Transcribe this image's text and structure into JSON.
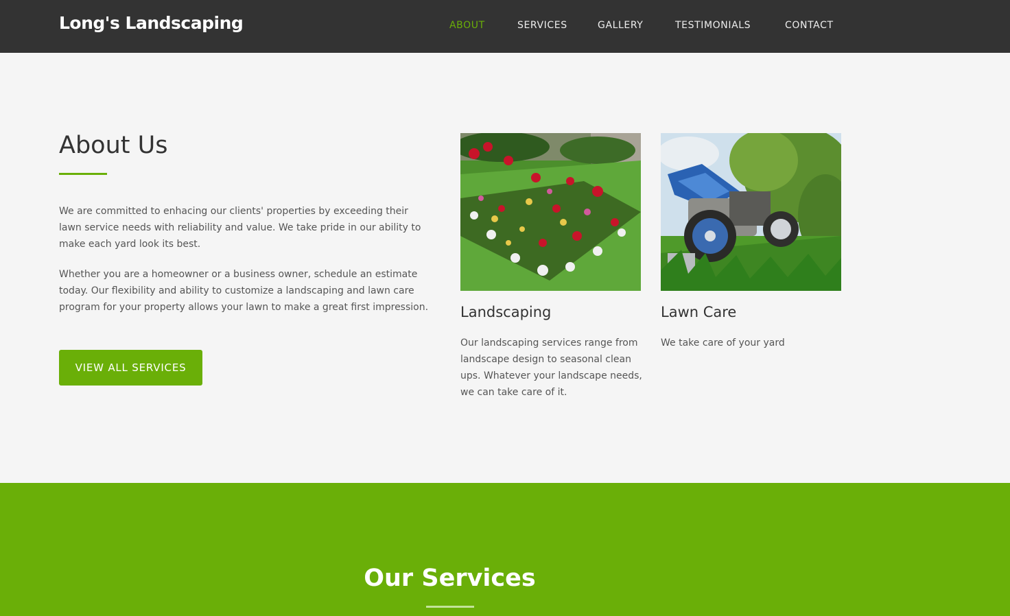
{
  "header": {
    "brand": "Long's Landscaping",
    "nav": [
      {
        "label": "ABOUT",
        "active": true
      },
      {
        "label": "SERVICES",
        "active": false
      },
      {
        "label": "GALLERY",
        "active": false
      },
      {
        "label": "TESTIMONIALS",
        "active": false
      },
      {
        "label": "CONTACT",
        "active": false
      }
    ]
  },
  "about": {
    "title": "About Us",
    "paragraphs": [
      "We are committed to enhacing our clients' properties by exceeding their lawn service needs with reliability and value. We take pride in our ability to make each yard look its best.",
      "Whether you are a homeowner or a business owner, schedule an estimate today. Our flexibility and ability to customize a landscaping and lawn care program for your property allows your lawn to make a great first impression."
    ],
    "button_label": "VIEW ALL SERVICES"
  },
  "cards": [
    {
      "title": "Landscaping",
      "text": "Our landscaping services range from landscape design to seasonal clean ups. Whatever your landscape needs, we can take care of it.",
      "image": "flower-garden-photo"
    },
    {
      "title": "Lawn Care",
      "text": "We take care of your yard",
      "image": "lawn-mower-photo"
    }
  ],
  "services_section": {
    "title": "Our Services"
  },
  "colors": {
    "accent": "#6aaf08",
    "navbar": "#333333",
    "page_bg": "#f5f5f5"
  }
}
